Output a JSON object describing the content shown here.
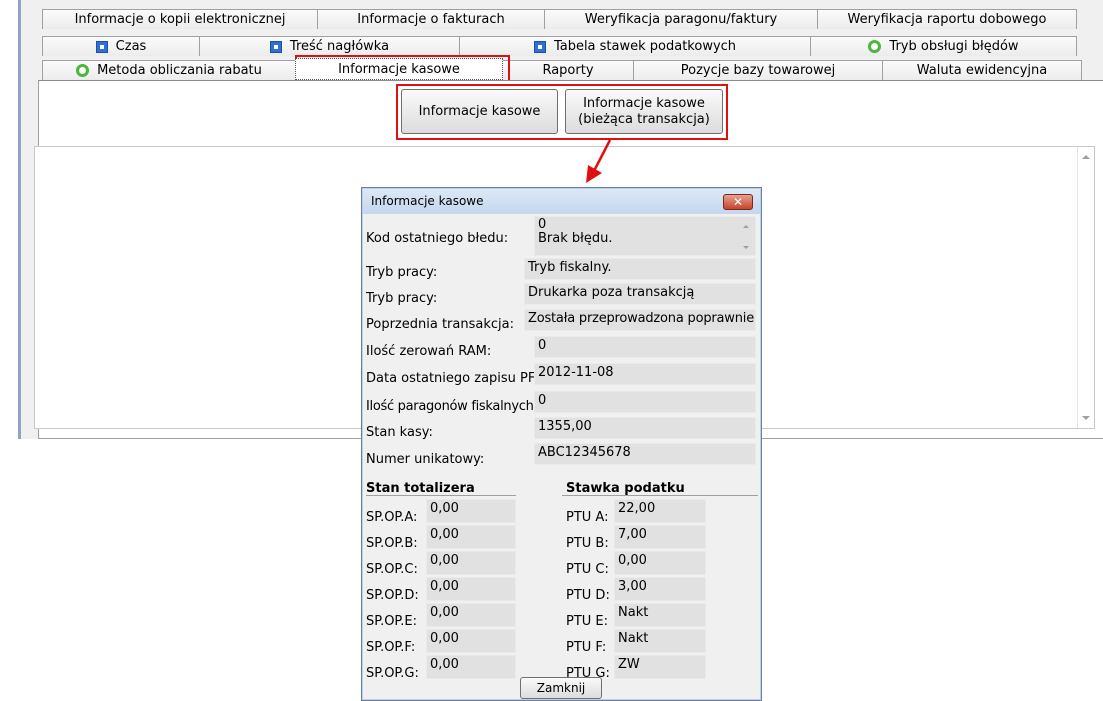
{
  "tabs": {
    "row1": [
      "Informacje o kopii elektronicznej",
      "Informacje o fakturach",
      "Weryfikacja paragonu/faktury",
      "Weryfikacja raportu dobowego"
    ],
    "row2": [
      "Czas",
      "Treść nagłówka",
      "Tabela stawek podatkowych",
      "Tryb obsługi błędów"
    ],
    "row3": [
      "Metoda obliczania rabatu",
      "Informacje kasowe",
      "Raporty",
      "Pozycje bazy towarowej",
      "Waluta ewidencyjna"
    ]
  },
  "buttons": {
    "info": "Informacje kasowe",
    "info_current_1": "Informacje kasowe",
    "info_current_2": "(bieżąca transakcja)"
  },
  "dialog": {
    "title": "Informacje kasowe",
    "close_label": "✕",
    "fields": [
      {
        "label": "Kod ostatniego błedu:",
        "value_1": "0",
        "value_2": "Brak błędu."
      },
      {
        "label": "Tryb pracy:",
        "value": "Tryb fiskalny."
      },
      {
        "label": "Tryb pracy:",
        "value": "Drukarka poza transakcją"
      },
      {
        "label": "Poprzednia transakcja:",
        "value": "Została przeprowadzona poprawnie"
      },
      {
        "label": "Ilość zerowań RAM:",
        "value": "0"
      },
      {
        "label": "Data ostatniego zapisu PF:",
        "value": "2012-11-08"
      },
      {
        "label": "Ilość paragonów fiskalnych:",
        "value": "0"
      },
      {
        "label": "Stan kasy:",
        "value": "1355,00"
      },
      {
        "label": "Numer unikatowy:",
        "value": "ABC12345678"
      }
    ],
    "totalizer_header": "Stan totalizera",
    "tax_header": "Stawka podatku",
    "totalizers": [
      {
        "label": "SP.OP.A:",
        "value": "0,00"
      },
      {
        "label": "SP.OP.B:",
        "value": "0,00"
      },
      {
        "label": "SP.OP.C:",
        "value": "0,00"
      },
      {
        "label": "SP.OP.D:",
        "value": "0,00"
      },
      {
        "label": "SP.OP.E:",
        "value": "0,00"
      },
      {
        "label": "SP.OP.F:",
        "value": "0,00"
      },
      {
        "label": "SP.OP.G:",
        "value": "0,00"
      }
    ],
    "taxes": [
      {
        "label": "PTU A:",
        "value": "22,00"
      },
      {
        "label": "PTU B:",
        "value": "7,00"
      },
      {
        "label": "PTU C:",
        "value": "0,00"
      },
      {
        "label": "PTU D:",
        "value": "3,00"
      },
      {
        "label": "PTU E:",
        "value": "Nakt"
      },
      {
        "label": "PTU F:",
        "value": "Nakt"
      },
      {
        "label": "PTU G:",
        "value": "ZW"
      }
    ],
    "close_button": "Zamknij"
  },
  "colors": {
    "highlight": "#e01010",
    "dialog_title": "#c4d7ee"
  }
}
